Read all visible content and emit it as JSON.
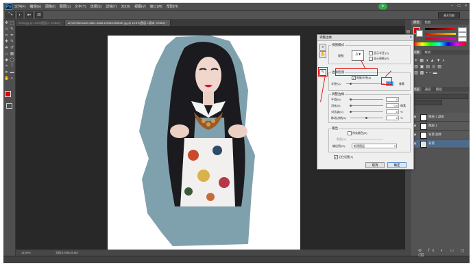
{
  "app": {
    "logo": "Ps",
    "menus": [
      "文件(F)",
      "编辑(E)",
      "图像(I)",
      "图层(L)",
      "文字(Y)",
      "选择(S)",
      "滤镜(T)",
      "3D(D)",
      "视图(V)",
      "窗口(W)",
      "帮助(H)"
    ],
    "window_controls": [
      "–",
      "□",
      "×"
    ],
    "workspace": "基本功能"
  },
  "options_bar": {
    "size_value": "30"
  },
  "tabs": [
    {
      "label": "9999.jpg @ 100%(图层 0, RGB/8) *",
      "active": false
    },
    {
      "label": "AF1BF560-6A2E-4B21-9688-10998C985D0E.jpg @ 16.5%(图层 0 副本, RGB/8) *",
      "active": true
    }
  ],
  "status": {
    "zoom": "16.59%",
    "doc": "文档:5.93M/35.6M"
  },
  "dialog": {
    "title": "调整边缘",
    "view_mode": {
      "group": "视图模式",
      "view_label": "视图:",
      "show_radius": "显示半径 (J)",
      "show_original": "显示原稿 (P)"
    },
    "edge_detection": {
      "group": "边缘检测",
      "smart_radius": "智能半径(A)",
      "radius_label": "半径(U):",
      "radius_value": "",
      "radius_unit": "像素"
    },
    "adjust_edge": {
      "group": "调整边缘",
      "rows": [
        {
          "label": "平滑(H):",
          "value": "0",
          "unit": ""
        },
        {
          "label": "羽化(E):",
          "value": "0.0",
          "unit": "像素"
        },
        {
          "label": "对比度(C):",
          "value": "0",
          "unit": "%"
        },
        {
          "label": "移动边缘(S):",
          "value": "0",
          "unit": "%"
        }
      ]
    },
    "output": {
      "group": "输出",
      "decontaminate": "净化颜色(D)",
      "amount_label": "数量(N):",
      "output_to_label": "输出到(O):",
      "output_to_value": "新建图层"
    },
    "remember": "记住设置(T)",
    "cancel": "取消",
    "ok": "确定"
  },
  "panels": {
    "color_tabs": [
      "颜色",
      "色板"
    ],
    "adjust_tabs": [
      "调整",
      "样式"
    ],
    "layer_tabs": [
      "图层",
      "通道",
      "路径"
    ],
    "layers": [
      {
        "name": "图层 1 副本",
        "selected": false
      },
      {
        "name": "图层 1",
        "selected": false
      },
      {
        "name": "背景 副本",
        "selected": false
      },
      {
        "name": "背景",
        "selected": true
      }
    ]
  },
  "colors": {
    "annotation": "#e21a1a",
    "foreground": "#e00000",
    "canvas": "#ffffff",
    "selection_bg": "#7fa1ad",
    "frame_bg": "#4a4a4a"
  }
}
